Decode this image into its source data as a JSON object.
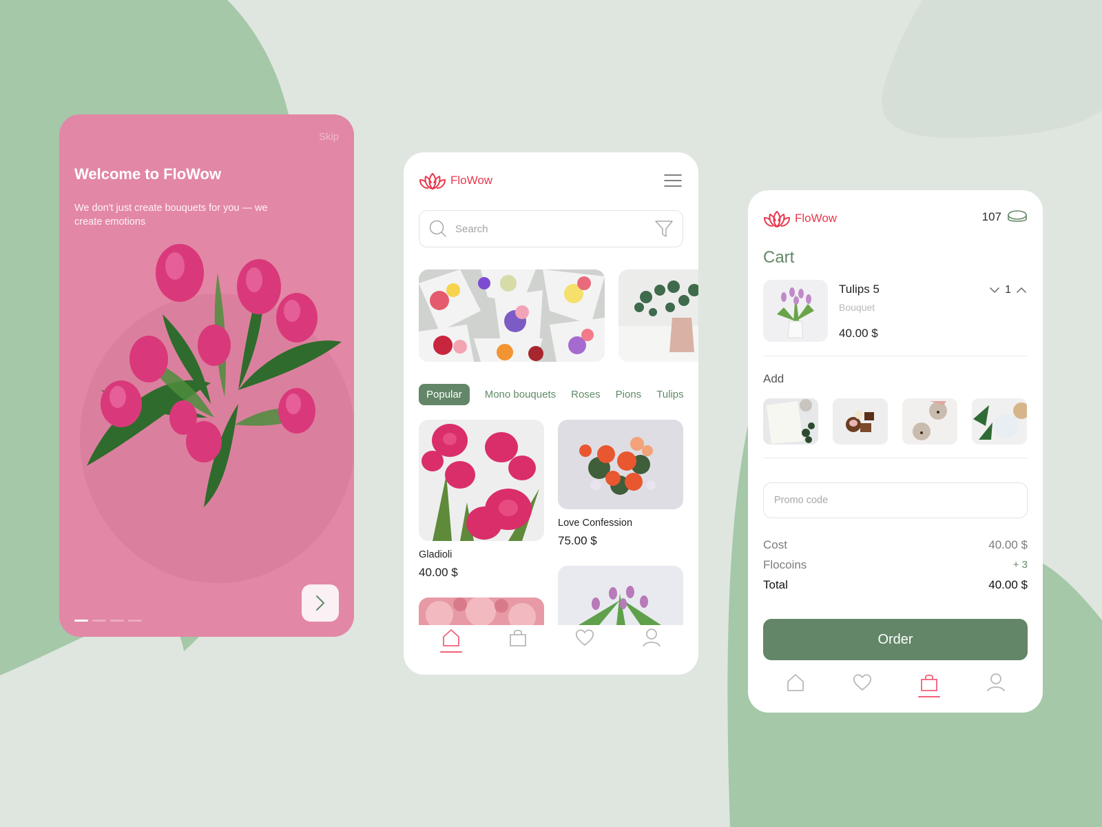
{
  "colors": {
    "background": "#dfe6df",
    "blob_green": "#a5c8a8",
    "onboarding_pink": "#e287a5",
    "brand_red": "#e8374c",
    "accent_green": "#628667",
    "nav_active": "#f2607a"
  },
  "onboarding": {
    "skip_label": "Skip",
    "title": "Welcome to FloWow",
    "subtitle": "We don't just create bouquets for you — we create emotions",
    "page_count": 4,
    "current_page": 1,
    "next_icon": "chevron-right-icon"
  },
  "catalog": {
    "brand": "FloWow",
    "search": {
      "placeholder": "Search",
      "value": ""
    },
    "banners": [
      "wrapped-bouquets-photo",
      "eucalyptus-vase-photo"
    ],
    "tabs": [
      {
        "label": "Popular",
        "active": true
      },
      {
        "label": "Mono bouquets",
        "active": false
      },
      {
        "label": "Roses",
        "active": false
      },
      {
        "label": "Pions",
        "active": false
      },
      {
        "label": "Tulips",
        "active": false
      }
    ],
    "products": [
      {
        "name": "Gladioli",
        "price": "40.00 $"
      },
      {
        "name": "Love Confession",
        "price": "75.00 $"
      },
      {
        "name": "",
        "price": ""
      },
      {
        "name": "",
        "price": ""
      }
    ],
    "nav": [
      {
        "icon": "home-icon",
        "active": true
      },
      {
        "icon": "bag-icon",
        "active": false
      },
      {
        "icon": "heart-icon",
        "active": false
      },
      {
        "icon": "user-icon",
        "active": false
      }
    ]
  },
  "cart": {
    "brand": "FloWow",
    "coins": "107",
    "title": "Cart",
    "item": {
      "name": "Tulips 5",
      "type": "Bouquet",
      "price": "40.00 $",
      "quantity": "1"
    },
    "add_title": "Add",
    "addons": [
      "card-photo",
      "chocolates-photo",
      "teddy-bears-photo",
      "balloons-photo"
    ],
    "promo": {
      "placeholder": "Promo code",
      "value": ""
    },
    "summary": {
      "cost_label": "Cost",
      "cost_value": "40.00 $",
      "flocoins_label": "Flocoins",
      "flocoins_value": "+ 3",
      "total_label": "Total",
      "total_value": "40.00 $"
    },
    "order_label": "Order",
    "nav": [
      {
        "icon": "home-icon",
        "active": false
      },
      {
        "icon": "heart-icon",
        "active": false
      },
      {
        "icon": "bag-icon",
        "active": true
      },
      {
        "icon": "user-icon",
        "active": false
      }
    ]
  }
}
